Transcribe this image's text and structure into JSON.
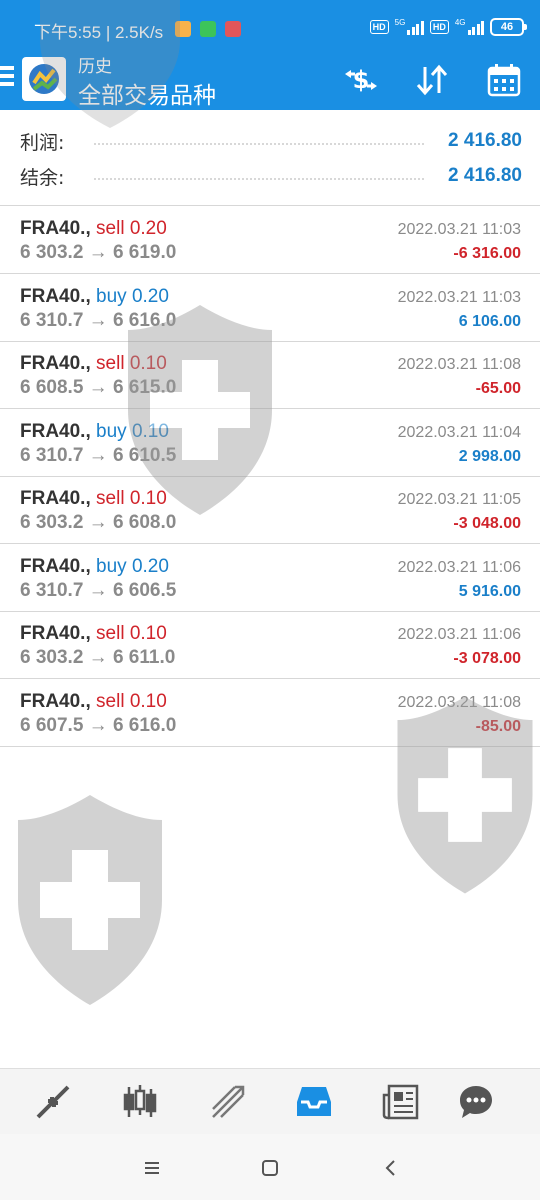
{
  "status_bar": {
    "time": "下午5:55",
    "speed": "2.5K/s",
    "hd1": "HD",
    "net1": "5G",
    "hd2": "HD",
    "net2": "4G",
    "battery": "46"
  },
  "header": {
    "title_small": "历史",
    "title_main": "全部交易品种"
  },
  "icons": {
    "menu": "hamburger-menu-icon",
    "logo": "metatrader-logo-icon",
    "currency": "currency-swap-icon",
    "sort": "sort-arrows-icon",
    "calendar": "calendar-icon"
  },
  "summary": {
    "profit_label": "利润:",
    "profit_value": "2 416.80",
    "balance_label": "结余:",
    "balance_value": "2 416.80"
  },
  "deals": [
    {
      "symbol": "FRA40.,",
      "side": "sell 0.20",
      "type": "sell",
      "prices": "6 303.2 → 6 619.0",
      "datetime": "2022.03.21 11:03",
      "profit": "-6 316.00"
    },
    {
      "symbol": "FRA40.,",
      "side": "buy 0.20",
      "type": "buy",
      "prices": "6 310.7 → 6 616.0",
      "datetime": "2022.03.21 11:03",
      "profit": "6 106.00"
    },
    {
      "symbol": "FRA40.,",
      "side": "sell 0.10",
      "type": "sell",
      "prices": "6 608.5 → 6 615.0",
      "datetime": "2022.03.21 11:08",
      "profit": "-65.00"
    },
    {
      "symbol": "FRA40.,",
      "side": "buy 0.10",
      "type": "buy",
      "prices": "6 310.7 → 6 610.5",
      "datetime": "2022.03.21 11:04",
      "profit": "2 998.00"
    },
    {
      "symbol": "FRA40.,",
      "side": "sell 0.10",
      "type": "sell",
      "prices": "6 303.2 → 6 608.0",
      "datetime": "2022.03.21 11:05",
      "profit": "-3 048.00"
    },
    {
      "symbol": "FRA40.,",
      "side": "buy 0.20",
      "type": "buy",
      "prices": "6 310.7 → 6 606.5",
      "datetime": "2022.03.21 11:06",
      "profit": "5 916.00"
    },
    {
      "symbol": "FRA40.,",
      "side": "sell 0.10",
      "type": "sell",
      "prices": "6 303.2 → 6 611.0",
      "datetime": "2022.03.21 11:06",
      "profit": "-3 078.00"
    },
    {
      "symbol": "FRA40.,",
      "side": "sell 0.10",
      "type": "sell",
      "prices": "6 607.5 → 6 616.0",
      "datetime": "2022.03.21 11:08",
      "profit": "-85.00"
    }
  ],
  "bottom_nav": [
    "quotes-icon",
    "chart-candles-icon",
    "trade-icon",
    "history-inbox-icon",
    "news-icon",
    "chat-icon"
  ],
  "colors": {
    "header_blue": "#1a8fe3",
    "sell_red": "#d0242b",
    "buy_blue": "#1a7fc9",
    "active_nav": "#1a8fe3"
  }
}
